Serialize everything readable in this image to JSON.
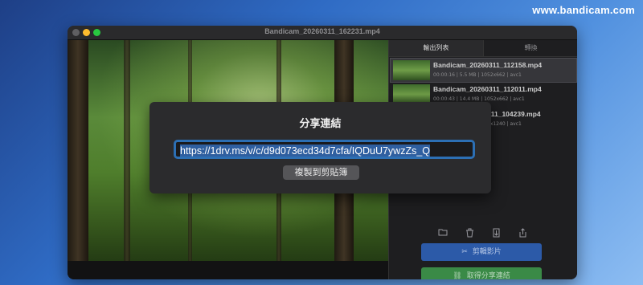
{
  "watermark": "www.bandicam.com",
  "window": {
    "title": "Bandicam_20260311_162231.mp4"
  },
  "tabs": [
    {
      "label": "輸出列表",
      "active": true
    },
    {
      "label": "轉換",
      "active": false
    }
  ],
  "files": [
    {
      "name": "Bandicam_20260311_112158.mp4",
      "meta": "00:00:16 | 5.5 MB | 1052x662 | avc1",
      "selected": true
    },
    {
      "name": "Bandicam_20260311_112011.mp4",
      "meta": "00:00:43 | 14.4 MB | 1052x662 | avc1",
      "selected": false
    },
    {
      "name": "311_104239.mp4",
      "meta": "1x1240 | avc1",
      "selected": false
    }
  ],
  "toolbar": {
    "icons": [
      "folder-icon",
      "trash-icon",
      "export-icon",
      "share-icon"
    ]
  },
  "buttons": {
    "cut_label": "剪輯影片",
    "share_label": "取得分享連結"
  },
  "dialog": {
    "title": "分享連結",
    "url": "https://1drv.ms/v/c/d9d073ecd34d7cfa/IQDuU7ywzZs_Q",
    "copy_label": "複製到剪貼簿"
  },
  "colors": {
    "cut_button": "#2c5aa8",
    "share_button": "#3a8a46",
    "url_focus": "#2c6fb4"
  }
}
